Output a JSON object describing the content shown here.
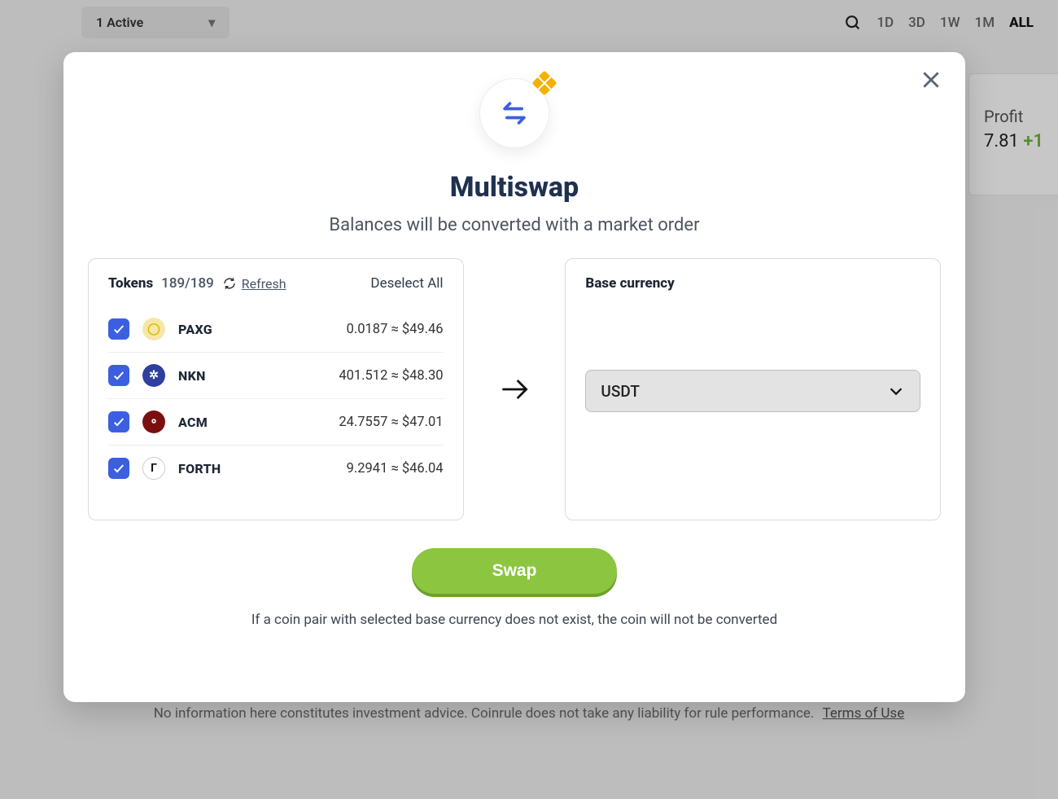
{
  "bg": {
    "active_filter_label": "1 Active",
    "ranges": [
      "1D",
      "3D",
      "1W",
      "1M",
      "ALL"
    ],
    "active_range": "ALL",
    "profit_label": "Profit",
    "profit_value": "7.81",
    "profit_gain_prefix": "+1",
    "disclaimer_text": "No information here constitutes investment advice. Coinrule does not take any liability for rule performance.",
    "terms_link": "Terms of Use"
  },
  "modal": {
    "title": "Multiswap",
    "subtitle": "Balances will be converted with a market order",
    "tokens_label": "Tokens",
    "tokens_count": "189/189",
    "refresh_label": "Refresh",
    "deselect_label": "Deselect All",
    "tokens": [
      {
        "symbol": "PAXG",
        "amount_text": "0.0187 ≈ $49.46",
        "icon_bg": "#f5e7a7",
        "icon_fg": "#d7b900",
        "glyph": "◯"
      },
      {
        "symbol": "NKN",
        "amount_text": "401.512 ≈ $48.30",
        "icon_bg": "#2e3f9e",
        "icon_fg": "#ffffff",
        "glyph": "✲"
      },
      {
        "symbol": "ACM",
        "amount_text": "24.7557 ≈ $47.01",
        "icon_bg": "#7b0f10",
        "icon_fg": "#ffffff",
        "glyph": "⚬"
      },
      {
        "symbol": "FORTH",
        "amount_text": "9.2941 ≈ $46.04",
        "icon_bg": "#ffffff",
        "icon_fg": "#111111",
        "glyph": "Γ"
      }
    ],
    "base_currency_label": "Base currency",
    "base_currency_value": "USDT",
    "swap_label": "Swap",
    "note": "If a coin pair with selected base currency does not exist, the coin will not be converted"
  }
}
